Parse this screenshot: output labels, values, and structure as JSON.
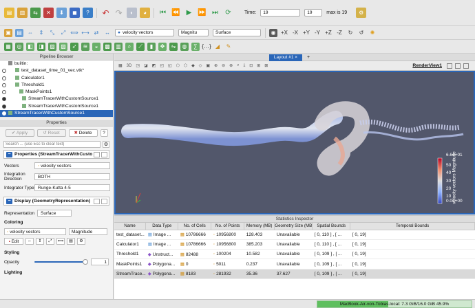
{
  "toolbar1": {
    "time_label": "Time:",
    "time_value": "19",
    "step_value": "19",
    "max_label": "max is 19"
  },
  "toolbar2": {
    "color_array": "velocity vectors",
    "component": "Magnitu",
    "representation": "Surface"
  },
  "pipeline": {
    "title": "Pipeline Browser",
    "items": [
      {
        "label": "builtin:"
      },
      {
        "label": "test_dataset_time_01_vec.vtk*"
      },
      {
        "label": "Calculator1"
      },
      {
        "label": "Threshold1"
      },
      {
        "label": "MaskPoints1"
      },
      {
        "label": "StreamTracerWithCustomSource1"
      },
      {
        "label": "StreamTracerWithCustomSource1"
      },
      {
        "label": "StreamTracerWithCustomSource1"
      }
    ]
  },
  "properties": {
    "title": "Properties",
    "apply": "Apply",
    "reset": "Reset",
    "delete": "Delete",
    "search_placeholder": "Search ... (use Esc to clear text)",
    "section1": "Properties (StreamTracerWithCustor",
    "vectors_label": "Vectors",
    "vectors_value": "velocity vectors",
    "integration_label": "Integration Direction",
    "integration_value": "BOTH",
    "integrator_label": "Integrator Type",
    "integrator_value": "Runge-Kutta 4-5",
    "section2": "Display (GeometryRepresentation)",
    "representation_label": "Representation",
    "representation_value": "Surface",
    "coloring_label": "Coloring",
    "coloring_value": "velocity vectors",
    "coloring_comp": "Magnitude",
    "edit": "Edit",
    "styling_label": "Styling",
    "opacity_label": "Opacity",
    "opacity_value": "1",
    "opacity_fraction": 1.0,
    "lighting_label": "Lighting"
  },
  "layout": {
    "tab": "Layout #1",
    "plus": "+",
    "view_name": "RenderView1",
    "view_3d": "3D"
  },
  "colorbar": {
    "title": "velocity vectors Magnitude",
    "max": "6.6e+01",
    "ticks": [
      "50",
      "40",
      "30",
      "20",
      "10"
    ],
    "min": "0.0e+00"
  },
  "stats": {
    "title": "Statistics Inspector",
    "columns": [
      "Name",
      "Data Type",
      "No. of Cells",
      "No. of Points",
      "Memory (MB)",
      "Geometry Size (MB",
      "Spatial Bounds",
      "Temporal Bounds"
    ],
    "rows": [
      [
        "test_dataset...",
        "Image ...",
        "10786666",
        "10956800",
        "128.403",
        "Unavailable",
        "[ 0, 110 ] , [ ...",
        "[ 0, 19]"
      ],
      [
        "Calculator1",
        "Image ...",
        "10786666",
        "10956800",
        "385.203",
        "Unavailable",
        "[ 0, 110 ] , [ ...",
        "[ 0, 19]"
      ],
      [
        "Threshold1",
        "Unstruct...",
        "82488",
        "100204",
        "10.582",
        "Unavailable",
        "[ 0, 109 ] , [ ...",
        "[ 0, 19]"
      ],
      [
        "MaskPoints1",
        "Polygona...",
        "0",
        "5011",
        "0.237",
        "Unavailable",
        "[ 0, 109 ] , [ ...",
        "[ 0, 19]"
      ],
      [
        "StreamTrace...",
        "Polygona...",
        "8183",
        "281932",
        "35.36",
        "37.627",
        "[ 0, 109 ] , [ ...",
        "[ 0, 19]"
      ]
    ]
  },
  "status": {
    "memory": "MacBook-Air-von-Tobias.local: 7.3 GiB/16.0 GiB 45.9%"
  },
  "colors": {
    "accent": "#2a66b8",
    "render_bg": "#52576b"
  }
}
